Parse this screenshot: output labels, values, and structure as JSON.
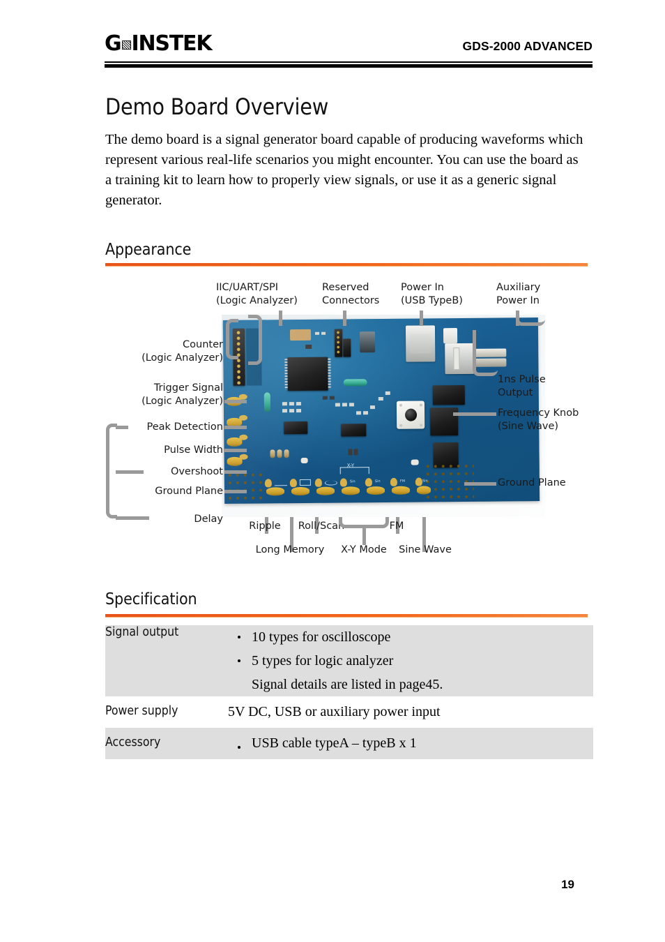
{
  "header": {
    "brand_prefix": "G",
    "brand_mid": "☰",
    "brand_suffix": "INSTEK",
    "brand_full": "GWINSTEK",
    "title": "GDS-2000 ADVANCED"
  },
  "page": {
    "doc_title": "Demo Board Overview",
    "intro": "The demo board is a signal generator board capable of producing waveforms which represent various real-life scenarios you might encounter. You can use the board as a training kit to learn how to properly view signals, or use it as a generic signal generator.",
    "page_number": "19",
    "accent_color": "#f2651a",
    "shade_color": "#dededf",
    "leader_color": "#9a9a9a"
  },
  "sections": {
    "appearance": "Appearance",
    "specification": "Specification"
  },
  "figure": {
    "callouts_top": [
      {
        "key": "iic_uart_spi",
        "text": "IIC/UART/SPI\n(Logic Analyzer)"
      },
      {
        "key": "reserved_connectors",
        "text": "Reserved\nConnectors"
      },
      {
        "key": "power_in",
        "text": "Power In\n(USB TypeB)"
      },
      {
        "key": "auxiliary_power_in",
        "text": "Auxiliary\nPower In"
      }
    ],
    "callouts_left": [
      {
        "key": "counter",
        "text": "Counter\n(Logic Analyzer)"
      },
      {
        "key": "trigger_signal",
        "text": "Trigger Signal\n(Logic Analyzer)"
      },
      {
        "key": "peak_detection",
        "text": "Peak Detection"
      },
      {
        "key": "pulse_width",
        "text": "Pulse Width"
      },
      {
        "key": "overshoot",
        "text": "Overshoot"
      },
      {
        "key": "ground_plane_left",
        "text": "Ground Plane"
      },
      {
        "key": "delay",
        "text": "Delay"
      }
    ],
    "callouts_right": [
      {
        "key": "pulse_output",
        "text": "1ns Pulse\nOutput"
      },
      {
        "key": "frequency_knob",
        "text": "Frequency Knob\n(Sine Wave)"
      },
      {
        "key": "ground_plane_right",
        "text": "Ground Plane"
      }
    ],
    "callouts_bottom": [
      {
        "key": "ripple",
        "text": "Ripple"
      },
      {
        "key": "roll_scan",
        "text": "Roll/Scan"
      },
      {
        "key": "fm",
        "text": "FM"
      },
      {
        "key": "long_memory",
        "text": "Long Memory"
      },
      {
        "key": "xy_mode",
        "text": "X-Y Mode"
      },
      {
        "key": "sine_wave",
        "text": "Sine Wave"
      }
    ],
    "board_silkscreen": {
      "xy": "X-Y",
      "sin_1": "Sin",
      "sin_2": "Sin",
      "fm": "FM",
      "sin_3": "Sin"
    }
  },
  "spec_table": {
    "rows": [
      {
        "label": "Signal output",
        "lines": [
          {
            "bullet": true,
            "text": "10 types for oscilloscope"
          },
          {
            "bullet": true,
            "text": "5 types for logic analyzer"
          },
          {
            "bullet": false,
            "text": "Signal details are listed in page45."
          }
        ]
      },
      {
        "label": "Power supply",
        "lines": [
          {
            "bullet": false,
            "text": "5V DC, USB or auxiliary power input"
          }
        ]
      },
      {
        "label": "Accessory",
        "lines": [
          {
            "bullet": true,
            "text": "USB cable typeA – typeB x 1"
          }
        ]
      }
    ]
  }
}
